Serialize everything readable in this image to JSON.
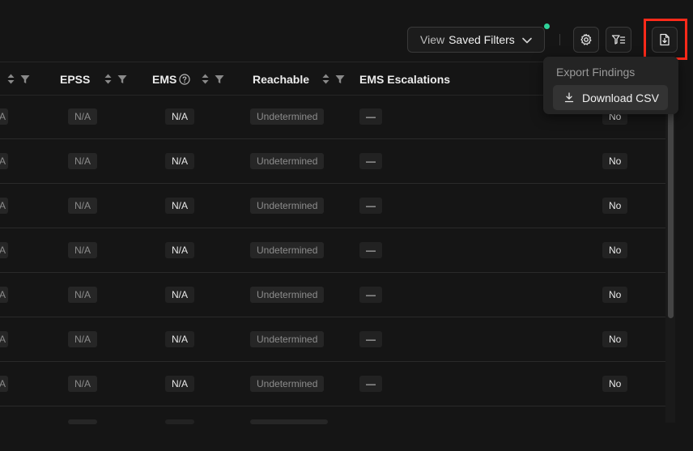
{
  "toolbar": {
    "view_label": "View",
    "saved_filters_label": "Saved Filters",
    "status_dot_color": "#2fd39a",
    "highlight_color": "#ff2a1a",
    "icons": [
      "settings-gear-icon",
      "filter-list-icon",
      "export-file-icon"
    ]
  },
  "table": {
    "columns": [
      "EPSS",
      "EMS",
      "Reachable",
      "EMS Escalations"
    ],
    "ems_info_icon": "info-circle-icon",
    "rows": [
      {
        "edge": "A",
        "epss": "N/A",
        "ems": "N/A",
        "reachable": "Undetermined",
        "escalations": "—",
        "last": "No"
      },
      {
        "edge": "A",
        "epss": "N/A",
        "ems": "N/A",
        "reachable": "Undetermined",
        "escalations": "—",
        "last": "No"
      },
      {
        "edge": "A",
        "epss": "N/A",
        "ems": "N/A",
        "reachable": "Undetermined",
        "escalations": "—",
        "last": "No"
      },
      {
        "edge": "A",
        "epss": "N/A",
        "ems": "N/A",
        "reachable": "Undetermined",
        "escalations": "—",
        "last": "No"
      },
      {
        "edge": "A",
        "epss": "N/A",
        "ems": "N/A",
        "reachable": "Undetermined",
        "escalations": "—",
        "last": "No"
      },
      {
        "edge": "A",
        "epss": "N/A",
        "ems": "N/A",
        "reachable": "Undetermined",
        "escalations": "—",
        "last": "No"
      },
      {
        "edge": "A",
        "epss": "N/A",
        "ems": "N/A",
        "reachable": "Undetermined",
        "escalations": "—",
        "last": "No"
      }
    ]
  },
  "dropdown": {
    "title": "Export Findings",
    "items": [
      {
        "label": "Download CSV",
        "icon": "download-icon"
      }
    ]
  }
}
